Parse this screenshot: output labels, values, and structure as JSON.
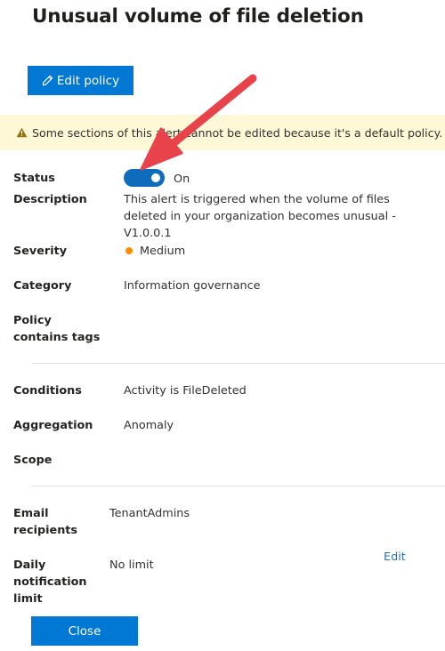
{
  "header": {
    "title": "Unusual volume of file deletion"
  },
  "toolbar": {
    "edit_policy_label": "Edit policy"
  },
  "warning": {
    "text": "Some sections of this alert cannot be edited because it's a default policy."
  },
  "details": {
    "status_label": "Status",
    "status_value": "On",
    "description_label": "Description",
    "description_value": "This alert is triggered when the volume of files deleted in your organization becomes unusual -V1.0.0.1",
    "severity_label": "Severity",
    "severity_value": "Medium",
    "category_label": "Category",
    "category_value": "Information governance",
    "tags_label_line1": "Policy",
    "tags_label_line2": "contains tags"
  },
  "conditions": {
    "conditions_label": "Conditions",
    "conditions_value": "Activity is FileDeleted",
    "aggregation_label": "Aggregation",
    "aggregation_value": "Anomaly",
    "scope_label": "Scope"
  },
  "notifications": {
    "email_label_line1": "Email",
    "email_label_line2": "recipients",
    "email_value": "TenantAdmins",
    "limit_label_line1": "Daily",
    "limit_label_line2": "notification",
    "limit_label_line3": "limit",
    "limit_value": "No limit",
    "edit_label": "Edit"
  },
  "footer": {
    "close_label": "Close"
  },
  "colors": {
    "primary": "#0078d4",
    "toggle_on": "#0f6cbd",
    "warning_background": "#fff8d6",
    "warning_icon": "#986f0b",
    "severity_medium": "#ff8c00",
    "link": "#2a6eb8",
    "annotation_arrow": "#e8424b"
  },
  "icons": {
    "edit": "pencil-icon",
    "warning": "warning-triangle-icon",
    "annotation": "red-arrow-icon"
  }
}
